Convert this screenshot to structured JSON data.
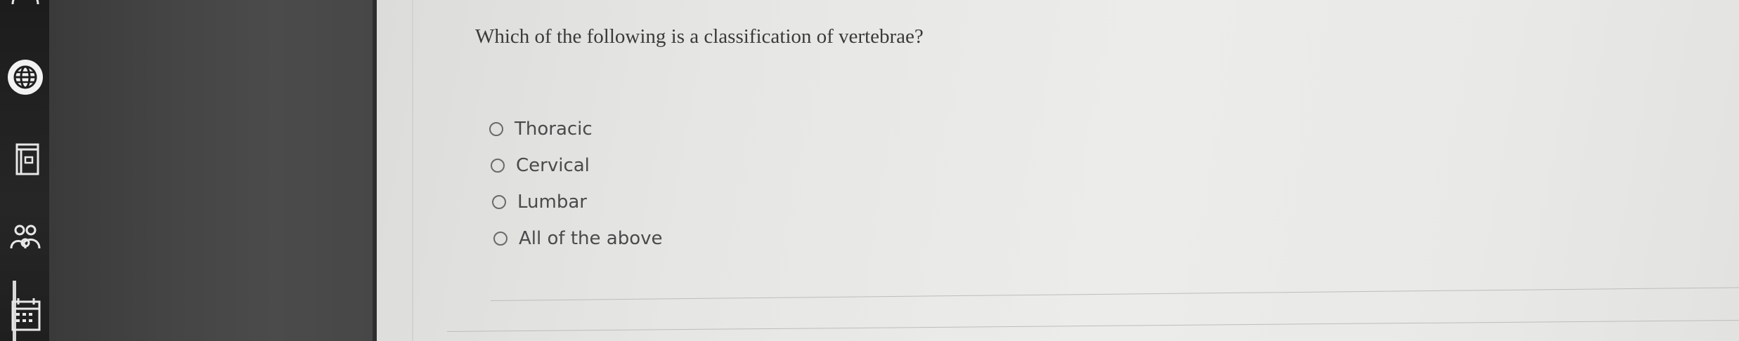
{
  "rail": {
    "icons": [
      "browser-globe-icon",
      "notebook-icon",
      "people-icon",
      "calendar-icon"
    ]
  },
  "quiz": {
    "question": "Which of the following is a classification of vertebrae?",
    "options": [
      {
        "label": "Thoracic",
        "selected": false
      },
      {
        "label": "Cervical",
        "selected": false
      },
      {
        "label": "Lumbar",
        "selected": false
      },
      {
        "label": "All of the above",
        "selected": false
      }
    ]
  },
  "colors": {
    "rail": "#1c1c1c",
    "side_panel": "#444444",
    "content_bg": "#e6e6e4",
    "text": "#3a3a3a"
  }
}
